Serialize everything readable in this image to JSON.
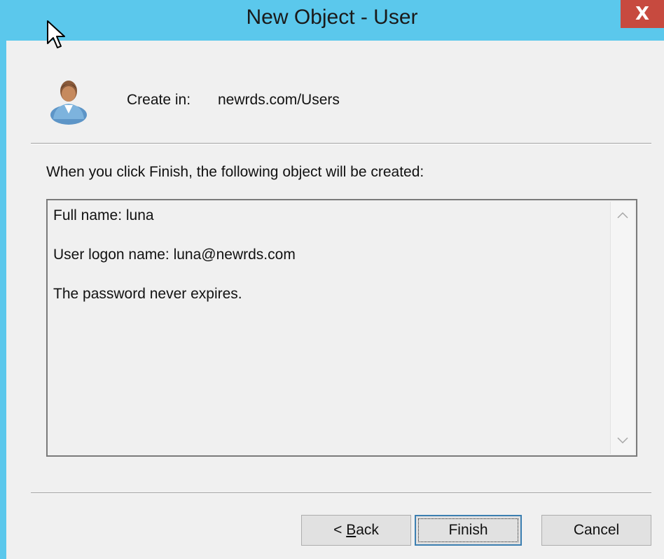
{
  "window": {
    "title": "New Object - User",
    "close_label": "X"
  },
  "header": {
    "create_in_label": "Create in:",
    "create_in_value": "newrds.com/Users"
  },
  "info_text": "When you click Finish, the following object will be created:",
  "summary": {
    "lines": [
      "Full name: luna",
      "User logon name: luna@newrds.com",
      "The password never expires."
    ]
  },
  "buttons": {
    "back_prefix": "< ",
    "back_mnemonic": "B",
    "back_rest": "ack",
    "finish": "Finish",
    "cancel": "Cancel"
  },
  "icons": {
    "user": "user-icon",
    "cursor": "cursor-icon",
    "scroll_up": "scroll-up-icon",
    "scroll_down": "scroll-down-icon"
  },
  "colors": {
    "titlebar": "#5bc8ec",
    "close": "#c74a3f",
    "dialog_bg": "#f0f0f0",
    "focus_border": "#3c7fb1"
  }
}
